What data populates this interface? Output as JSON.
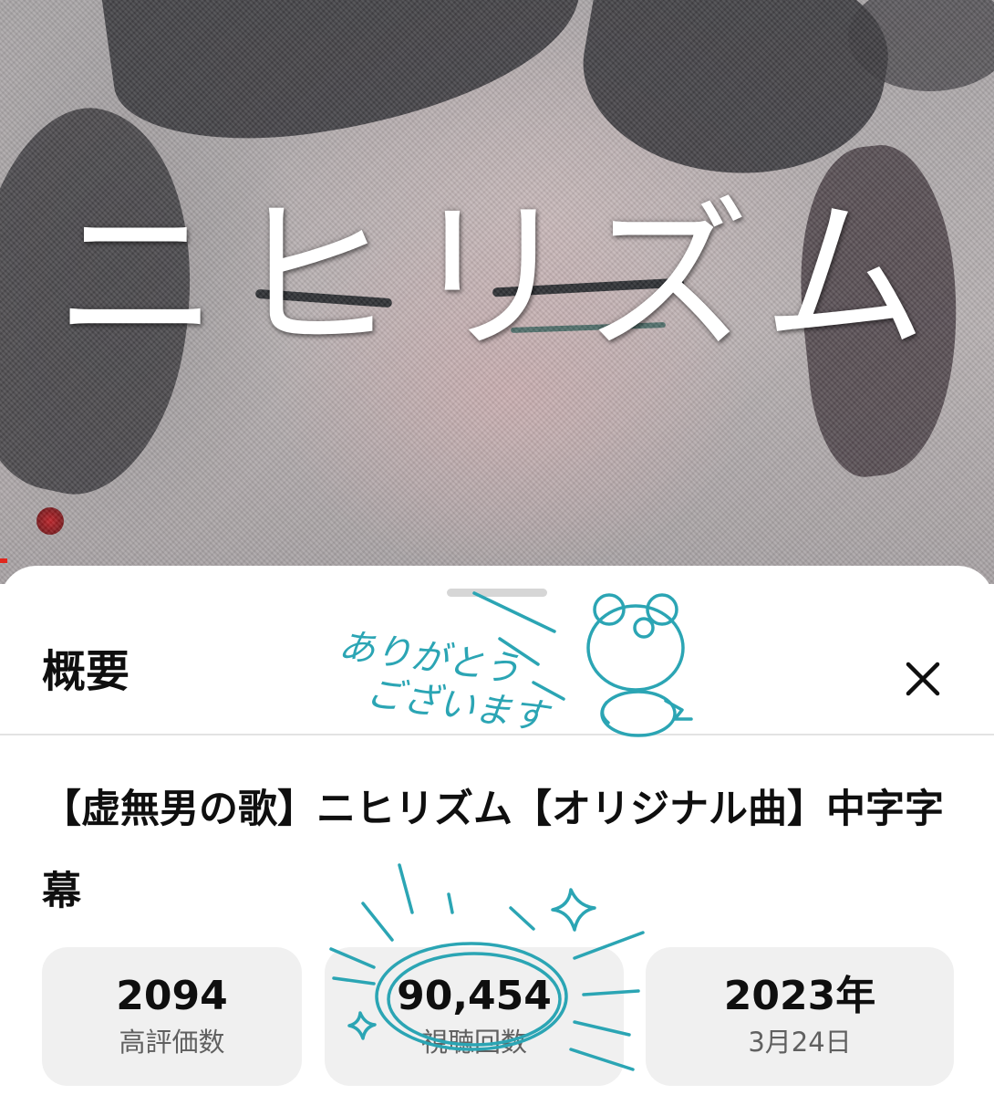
{
  "thumbnail": {
    "overlay_title": "ニヒリズム",
    "progress_percent": 0.7
  },
  "sheet": {
    "header_title": "概要",
    "close_icon": "close-icon",
    "video_title": "【虚無男の歌】ニヒリズム【オリジナル曲】中字字幕"
  },
  "stats": [
    {
      "value": "2094",
      "label": "高評価数"
    },
    {
      "value": "90,454",
      "label": "視聴回数"
    },
    {
      "value": "2023年",
      "label": "3月24日"
    }
  ],
  "annotation": {
    "line1": "ありがとう",
    "line2": "ございます",
    "color": "#2ba5b4"
  }
}
